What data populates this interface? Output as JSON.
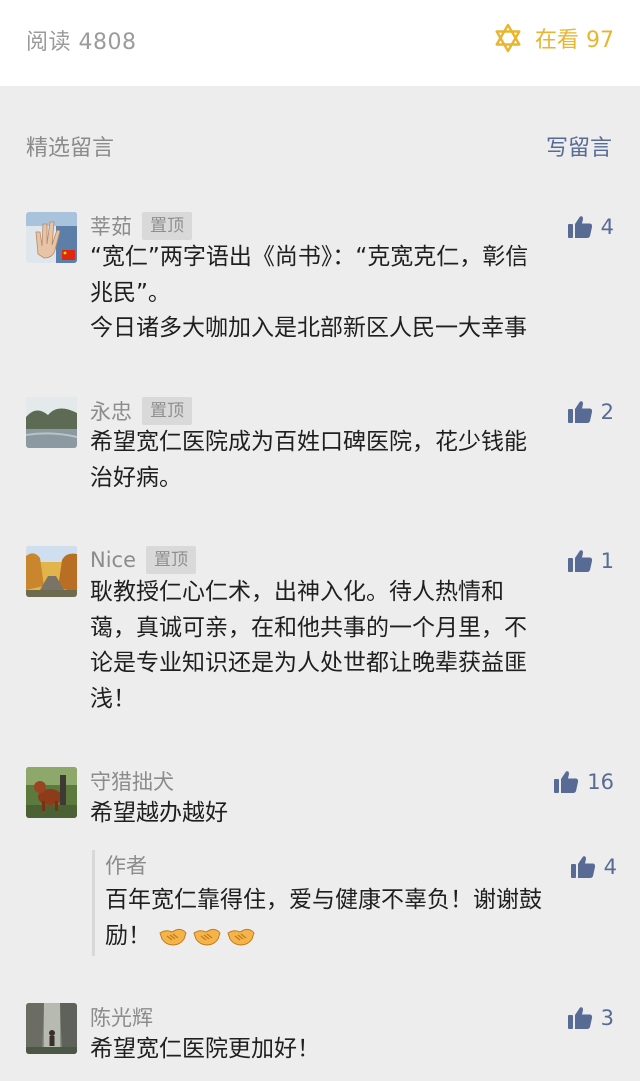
{
  "header": {
    "read_label": "阅读 4808",
    "watching_label": "在看 97",
    "watching_icon": "star-of-david-icon",
    "accent_color": "#e8b52e"
  },
  "section": {
    "title": "精选留言",
    "write_label": "写留言",
    "link_color": "#576b95"
  },
  "comments": [
    {
      "nick": "莘茹",
      "pinned": "置顶",
      "likes": "4",
      "lines": [
        "“宽仁”两字语出《尚书》：“克宽克仁，彰信",
        "兆民”。",
        "今日诸多大咖加入是北部新区人民一大幸事"
      ]
    },
    {
      "nick": "永忠",
      "pinned": "置顶",
      "likes": "2",
      "lines": [
        "希望宽仁医院成为百姓口碑医院，花少钱能",
        "治好病。"
      ]
    },
    {
      "nick": "Nice",
      "pinned": "置顶",
      "likes": "1",
      "lines": [
        "耿教授仁心仁术，出神入化。待人热情和",
        "蔼，真诚可亲，在和他共事的一个月里，不",
        "论是专业知识还是为人处世都让晚辈获益匪",
        "浅！"
      ]
    },
    {
      "nick": "守猎拙犬",
      "likes": "16",
      "lines": [
        "希望越办越好"
      ],
      "reply": {
        "author": "作者",
        "likes": "4",
        "lines": [
          "百年宽仁靠得住，爱与健康不辜负！谢谢鼓",
          "励！"
        ],
        "emoji": "handshake-emoji"
      }
    },
    {
      "nick": "陈光辉",
      "likes": "3",
      "lines": [
        "希望宽仁医院更加好！"
      ]
    }
  ]
}
